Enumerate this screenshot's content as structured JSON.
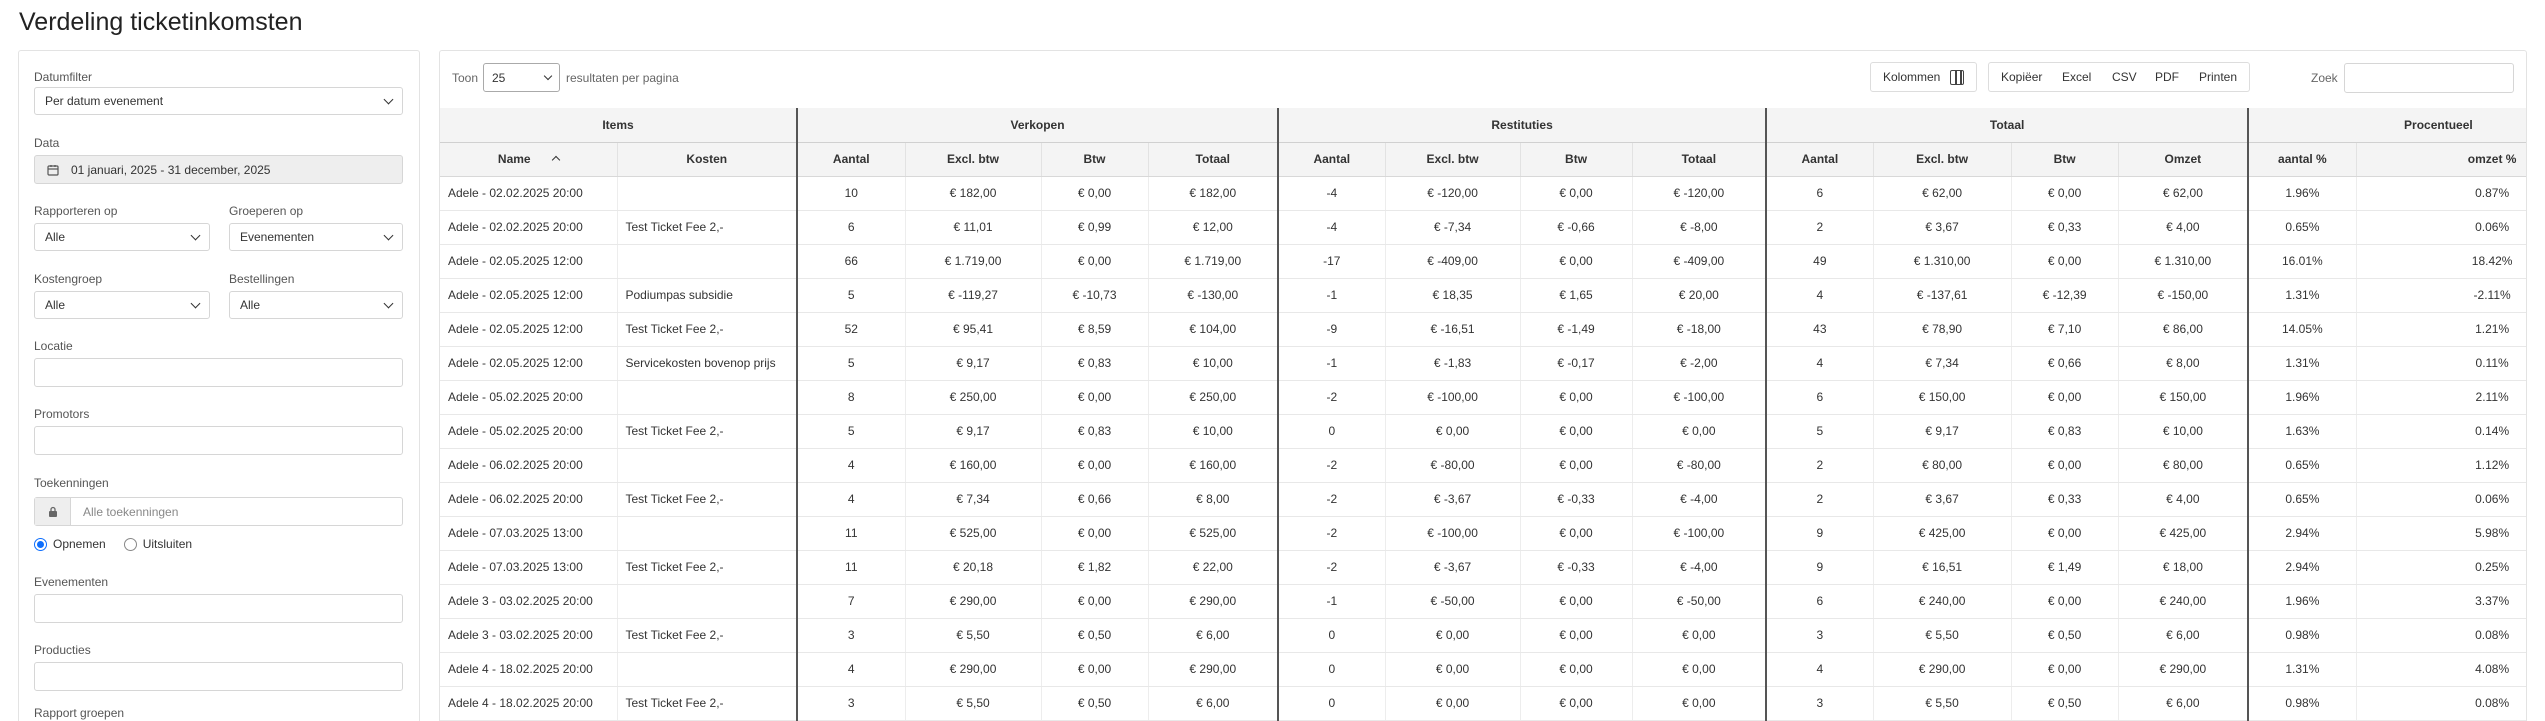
{
  "page": {
    "title": "Verdeling ticketinkomsten"
  },
  "filters": {
    "datumfilter": {
      "label": "Datumfilter",
      "value": "Per datum evenement"
    },
    "data": {
      "label": "Data",
      "value": "01 januari, 2025 - 31 december, 2025"
    },
    "rapporteren_op": {
      "label": "Rapporteren op",
      "value": "Alle"
    },
    "groeperen_op": {
      "label": "Groeperen op",
      "value": "Evenementen"
    },
    "kostengroep": {
      "label": "Kostengroep",
      "value": "Alle"
    },
    "bestellingen": {
      "label": "Bestellingen",
      "value": "Alle"
    },
    "locatie": {
      "label": "Locatie"
    },
    "promotors": {
      "label": "Promotors"
    },
    "toekenningen": {
      "label": "Toekenningen",
      "placeholder": "Alle toekenningen",
      "opt_include": "Opnemen",
      "opt_exclude": "Uitsluiten"
    },
    "evenementen": {
      "label": "Evenementen"
    },
    "producties": {
      "label": "Producties"
    },
    "rapport_groepen": {
      "label": "Rapport groepen"
    }
  },
  "toolbar": {
    "show_label": "Toon",
    "page_size": "25",
    "show_suffix": "resultaten per pagina",
    "columns_label": "Kolommen",
    "copy_label": "Kopiëer",
    "excel_label": "Excel",
    "csv_label": "CSV",
    "pdf_label": "PDF",
    "print_label": "Printen",
    "search_label": "Zoek"
  },
  "table": {
    "groups": [
      "Items",
      "Verkopen",
      "Restituties",
      "Totaal",
      "Procentueel"
    ],
    "columns": [
      "Name",
      "Kosten",
      "Aantal",
      "Excl. btw",
      "Btw",
      "Totaal",
      "Aantal",
      "Excl. btw",
      "Btw",
      "Totaal",
      "Aantal",
      "Excl. btw",
      "Btw",
      "Omzet",
      "aantal %",
      "omzet %"
    ],
    "rows": [
      [
        "Adele - 02.02.2025 20:00",
        "",
        "10",
        "€ 182,00",
        "€ 0,00",
        "€ 182,00",
        "-4",
        "€ -120,00",
        "€ 0,00",
        "€ -120,00",
        "6",
        "€ 62,00",
        "€ 0,00",
        "€ 62,00",
        "1.96%",
        "0.87%"
      ],
      [
        "Adele - 02.02.2025 20:00",
        "Test Ticket Fee 2,-",
        "6",
        "€ 11,01",
        "€ 0,99",
        "€ 12,00",
        "-4",
        "€ -7,34",
        "€ -0,66",
        "€ -8,00",
        "2",
        "€ 3,67",
        "€ 0,33",
        "€ 4,00",
        "0.65%",
        "0.06%"
      ],
      [
        "Adele - 02.05.2025 12:00",
        "",
        "66",
        "€ 1.719,00",
        "€ 0,00",
        "€ 1.719,00",
        "-17",
        "€ -409,00",
        "€ 0,00",
        "€ -409,00",
        "49",
        "€ 1.310,00",
        "€ 0,00",
        "€ 1.310,00",
        "16.01%",
        "18.42%"
      ],
      [
        "Adele - 02.05.2025 12:00",
        "Podiumpas subsidie",
        "5",
        "€ -119,27",
        "€ -10,73",
        "€ -130,00",
        "-1",
        "€ 18,35",
        "€ 1,65",
        "€ 20,00",
        "4",
        "€ -137,61",
        "€ -12,39",
        "€ -150,00",
        "1.31%",
        "-2.11%"
      ],
      [
        "Adele - 02.05.2025 12:00",
        "Test Ticket Fee 2,-",
        "52",
        "€ 95,41",
        "€ 8,59",
        "€ 104,00",
        "-9",
        "€ -16,51",
        "€ -1,49",
        "€ -18,00",
        "43",
        "€ 78,90",
        "€ 7,10",
        "€ 86,00",
        "14.05%",
        "1.21%"
      ],
      [
        "Adele - 02.05.2025 12:00",
        "Servicekosten bovenop prijs",
        "5",
        "€ 9,17",
        "€ 0,83",
        "€ 10,00",
        "-1",
        "€ -1,83",
        "€ -0,17",
        "€ -2,00",
        "4",
        "€ 7,34",
        "€ 0,66",
        "€ 8,00",
        "1.31%",
        "0.11%"
      ],
      [
        "Adele - 05.02.2025 20:00",
        "",
        "8",
        "€ 250,00",
        "€ 0,00",
        "€ 250,00",
        "-2",
        "€ -100,00",
        "€ 0,00",
        "€ -100,00",
        "6",
        "€ 150,00",
        "€ 0,00",
        "€ 150,00",
        "1.96%",
        "2.11%"
      ],
      [
        "Adele - 05.02.2025 20:00",
        "Test Ticket Fee 2,-",
        "5",
        "€ 9,17",
        "€ 0,83",
        "€ 10,00",
        "0",
        "€ 0,00",
        "€ 0,00",
        "€ 0,00",
        "5",
        "€ 9,17",
        "€ 0,83",
        "€ 10,00",
        "1.63%",
        "0.14%"
      ],
      [
        "Adele - 06.02.2025 20:00",
        "",
        "4",
        "€ 160,00",
        "€ 0,00",
        "€ 160,00",
        "-2",
        "€ -80,00",
        "€ 0,00",
        "€ -80,00",
        "2",
        "€ 80,00",
        "€ 0,00",
        "€ 80,00",
        "0.65%",
        "1.12%"
      ],
      [
        "Adele - 06.02.2025 20:00",
        "Test Ticket Fee 2,-",
        "4",
        "€ 7,34",
        "€ 0,66",
        "€ 8,00",
        "-2",
        "€ -3,67",
        "€ -0,33",
        "€ -4,00",
        "2",
        "€ 3,67",
        "€ 0,33",
        "€ 4,00",
        "0.65%",
        "0.06%"
      ],
      [
        "Adele - 07.03.2025 13:00",
        "",
        "11",
        "€ 525,00",
        "€ 0,00",
        "€ 525,00",
        "-2",
        "€ -100,00",
        "€ 0,00",
        "€ -100,00",
        "9",
        "€ 425,00",
        "€ 0,00",
        "€ 425,00",
        "2.94%",
        "5.98%"
      ],
      [
        "Adele - 07.03.2025 13:00",
        "Test Ticket Fee 2,-",
        "11",
        "€ 20,18",
        "€ 1,82",
        "€ 22,00",
        "-2",
        "€ -3,67",
        "€ -0,33",
        "€ -4,00",
        "9",
        "€ 16,51",
        "€ 1,49",
        "€ 18,00",
        "2.94%",
        "0.25%"
      ],
      [
        "Adele 3 - 03.02.2025 20:00",
        "",
        "7",
        "€ 290,00",
        "€ 0,00",
        "€ 290,00",
        "-1",
        "€ -50,00",
        "€ 0,00",
        "€ -50,00",
        "6",
        "€ 240,00",
        "€ 0,00",
        "€ 240,00",
        "1.96%",
        "3.37%"
      ],
      [
        "Adele 3 - 03.02.2025 20:00",
        "Test Ticket Fee 2,-",
        "3",
        "€ 5,50",
        "€ 0,50",
        "€ 6,00",
        "0",
        "€ 0,00",
        "€ 0,00",
        "€ 0,00",
        "3",
        "€ 5,50",
        "€ 0,50",
        "€ 6,00",
        "0.98%",
        "0.08%"
      ],
      [
        "Adele 4 - 18.02.2025 20:00",
        "",
        "4",
        "€ 290,00",
        "€ 0,00",
        "€ 290,00",
        "0",
        "€ 0,00",
        "€ 0,00",
        "€ 0,00",
        "4",
        "€ 290,00",
        "€ 0,00",
        "€ 290,00",
        "1.31%",
        "4.08%"
      ],
      [
        "Adele 4 - 18.02.2025 20:00",
        "Test Ticket Fee 2,-",
        "3",
        "€ 5,50",
        "€ 0,50",
        "€ 6,00",
        "0",
        "€ 0,00",
        "€ 0,00",
        "€ 0,00",
        "3",
        "€ 5,50",
        "€ 0,50",
        "€ 6,00",
        "0.98%",
        "0.08%"
      ]
    ]
  }
}
